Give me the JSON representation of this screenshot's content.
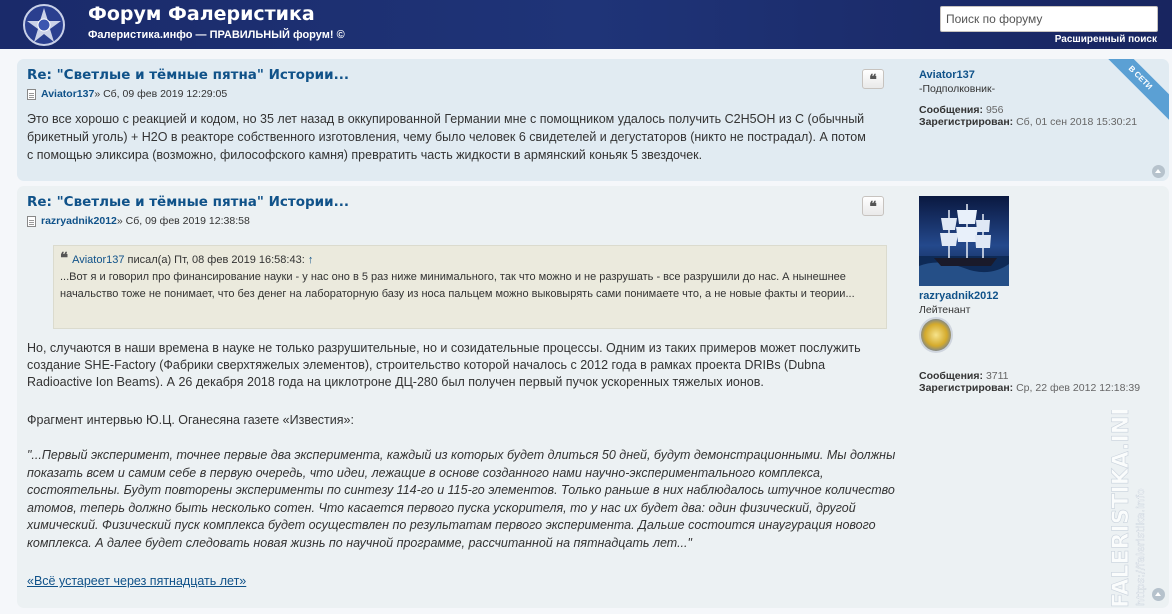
{
  "header": {
    "title": "Форум Фалеристика",
    "description": "Фалеристика.инфо — ПРАВИЛЬНЫЙ форум! ©",
    "search_placeholder": "Поиск по форуму",
    "advanced_search": "Расширенный поиск"
  },
  "posts": [
    {
      "title": "Re: \"Светлые и тёмные пятна\" Истории...",
      "author": "Aviator137",
      "date": " » Сб, 09 фев 2019 12:29:05",
      "quote_button": "❝",
      "body": "Это все хорошо с реакцией и кодом, но 35 лет назад в оккупированной Германии мне с помощником удалось получить С2Н5ОН из С (обычный брикетный уголь) + Н2О в реакторе собственного изготовления, чему было человек 6 свидетелей и дегустаторов (никто не пострадал). А потом с помощью эликсира (возможно, философского камня) превратить часть жидкости в армянский коньяк 5 звездочек.",
      "online_badge": "В СЕТИ",
      "profile": {
        "name": "Aviator137",
        "rank": "-Подполковник-",
        "posts_label": "Сообщения:",
        "posts": "956",
        "reg_label": "Зарегистрирован:",
        "reg_date": "Сб, 01 сен 2018 15:30:21"
      }
    },
    {
      "title": "Re: \"Светлые и тёмные пятна\" Истории...",
      "author": "razryadnik2012",
      "date": " » Сб, 09 фев 2019 12:38:58",
      "quote_button": "❝",
      "quote": {
        "author": "Aviator137",
        "wrote": " писал(а) Пт, 08 фев 2019 16:58:43: ",
        "arrow": "↑",
        "text": "...Вот я и говорил про финансирование науки - у нас оно в 5 раз ниже минимального, так что можно и не разрушать - все разрушили до нас. А нынешнее начальство тоже не понимает, что без денег на лабораторную базу из носа пальцем можно выковырять сами понимаете что, а не новые факты и теории..."
      },
      "body": "Но, случаются в наши времена в науке не только разрушительные, но и созидательные процессы. Одним из таких примеров может послужить создание SHE-Factory (Фабрики сверхтяжелых элементов), строительство которой началось с 2012 года в рамках проекта DRIBs (Dubna Radioactive Ion Beams). А 26 декабря 2018 года на циклотроне ДЦ-280 был получен первый пучок ускоренных тяжелых ионов.",
      "fragment": "Фрагмент интервью Ю.Ц. Оганесяна газете «Известия»:",
      "italic": "\"...Первый эксперимент, точнее первые два эксперимента, каждый из которых будет длиться 50 дней, будут демонстрационными. Мы должны показать всем и самим себе в первую очередь, что идеи, лежащие в основе созданного нами научно-экспериментального комплекса, состоятельны. Будут повторены эксперименты по синтезу 114-го и 115-го элементов. Только раньше в них наблюдалось штучное количество атомов, теперь должно быть несколько сотен. Что касается первого пуска ускорителя, то у нас их будет два: один физический, другой химический. Физический пуск комплекса будет осуществлен по результатам первого эксперимента. Дальше состоится инаугурация нового комплекса. А далее будет следовать новая жизнь по научной программе, рассчитанной на пятнадцать лет...\"",
      "link": "«Всё устареет через пятнадцать лет»",
      "profile": {
        "name": "razryadnik2012",
        "rank": "Лейтенант",
        "posts_label": "Сообщения:",
        "posts": "3711",
        "reg_label": "Зарегистрирован:",
        "reg_date": "Ср, 22 фев 2012 12:18:39"
      }
    }
  ],
  "watermark": {
    "main": "FALERISTIKA.INFO",
    "sub": "https://faleristika.info"
  }
}
